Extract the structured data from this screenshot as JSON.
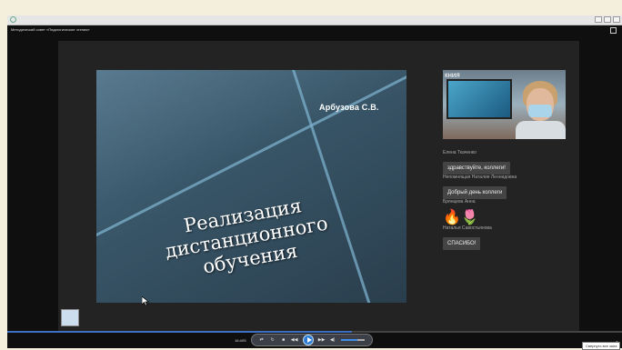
{
  "window": {
    "video_title": "Методический совет «Педагогические чтения»"
  },
  "slide": {
    "author": "Арбузова С.В.",
    "title_lines": [
      "Реализация",
      "дистанционного",
      "обучения"
    ]
  },
  "webcam": {
    "overlay_text": "кния"
  },
  "chat": [
    {
      "name": "Елена Ткаченко",
      "message": "здравствуйте, коллеги!"
    },
    {
      "name": "Непомнящая Наталия Леонидовна",
      "message": "Добрый день коллеги"
    },
    {
      "name": "Брянцева Анна",
      "message": "🔥🌷"
    },
    {
      "name": "Наталья Савостьянова",
      "message": "СПАСИБО!"
    }
  ],
  "player": {
    "time": "16:4Л5",
    "progress_fraction": 0.56,
    "volume_fraction": 0.7,
    "tooltip": "Свернуть все окна",
    "icons": [
      "shuffle-icon",
      "repeat-icon",
      "stop-icon",
      "rewind-icon",
      "play-icon",
      "fast-forward-icon",
      "volume-icon"
    ],
    "accent_color": "#2d7ad6"
  }
}
